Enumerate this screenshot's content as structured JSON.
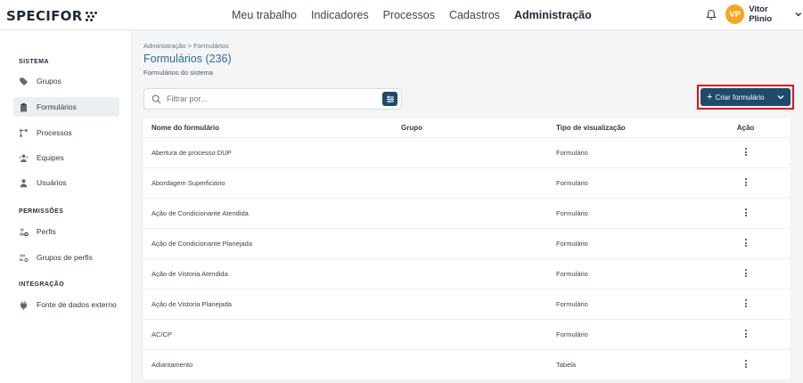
{
  "app": {
    "logo_text": "SPECIFOR",
    "nav": [
      "Meu trabalho",
      "Indicadores",
      "Processos",
      "Cadastros",
      "Administração"
    ],
    "active_nav": "Administração",
    "user": {
      "initials": "VP",
      "name": "Vitor Plinio"
    }
  },
  "sidebar": {
    "sections": [
      {
        "title": "SISTEMA",
        "items": [
          {
            "label": "Grupos",
            "icon": "tag-icon"
          },
          {
            "label": "Formulários",
            "icon": "clipboard-icon",
            "active": true
          },
          {
            "label": "Processos",
            "icon": "process-icon"
          },
          {
            "label": "Equipes",
            "icon": "team-icon"
          },
          {
            "label": "Usuários",
            "icon": "user-icon"
          }
        ]
      },
      {
        "title": "PERMISSÕES",
        "items": [
          {
            "label": "Perfis",
            "icon": "user-gear-icon"
          },
          {
            "label": "Grupos de perfis",
            "icon": "users-gear-icon"
          }
        ]
      },
      {
        "title": "INTEGRAÇÃO",
        "items": [
          {
            "label": "Fonte de dados externo",
            "icon": "plug-icon"
          }
        ]
      }
    ]
  },
  "main": {
    "breadcrumb": "Administração > Formulários",
    "title": "Formulários (236)",
    "subtitle": "Formulários do sistema",
    "search": {
      "placeholder": "Filtrar por...",
      "value": ""
    },
    "create_button": "Criar formulário",
    "table": {
      "columns": [
        "Nome do formulário",
        "Grupo",
        "Tipo de visualização",
        "Ação"
      ],
      "rows": [
        {
          "name": "Abertura de processo DUP",
          "group": "",
          "type": "Formulário"
        },
        {
          "name": "Abordagem Superficiário",
          "group": "",
          "type": "Formulário"
        },
        {
          "name": "Ação de Condicionante Atendida",
          "group": "",
          "type": "Formulário"
        },
        {
          "name": "Ação de Condicionante Planejada",
          "group": "",
          "type": "Formulário"
        },
        {
          "name": "Ação de Vistoria Atendida",
          "group": "",
          "type": "Formulário"
        },
        {
          "name": "Ação de Vistoria Planejada",
          "group": "",
          "type": "Formulário"
        },
        {
          "name": "AC/CP",
          "group": "",
          "type": "Formulário"
        },
        {
          "name": "Adiantamento",
          "group": "",
          "type": "Tabela"
        }
      ]
    }
  },
  "colors": {
    "primary": "#1e4a6b",
    "title": "#2c6c8e",
    "avatar": "#f5a623",
    "highlight": "#e0101a"
  }
}
